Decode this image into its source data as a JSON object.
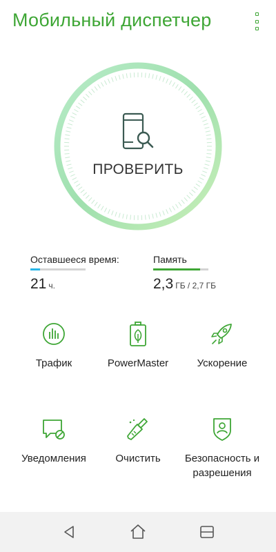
{
  "app": {
    "title": "Мобильный диспетчер",
    "accent_color": "#3ea635",
    "menu_icon": "more-vertical-icon"
  },
  "check": {
    "label": "ПРОВЕРИТЬ",
    "icon": "phone-search-icon"
  },
  "stats": {
    "time": {
      "label": "Оставшееся время:",
      "value": "21",
      "unit": "ч.",
      "bar_fraction": 0.17,
      "bar_color": "#29b6e8"
    },
    "memory": {
      "label": "Память",
      "value": "2,3",
      "unit": "ГБ / 2,7 ГБ",
      "bar_fraction": 0.85,
      "bar_color": "#3ea635"
    }
  },
  "tools": [
    {
      "label": "Трафик",
      "icon": "traffic-chart-icon"
    },
    {
      "label": "PowerMaster",
      "icon": "battery-leaf-icon"
    },
    {
      "label": "Ускорение",
      "icon": "rocket-icon"
    },
    {
      "label": "Уведомления",
      "icon": "notification-block-icon"
    },
    {
      "label": "Очистить",
      "icon": "broom-icon"
    },
    {
      "label": "Безопасность и разрешения",
      "icon": "shield-user-icon"
    }
  ],
  "nav": {
    "back_icon": "back-icon",
    "home_icon": "home-icon",
    "recents_icon": "recents-icon"
  }
}
